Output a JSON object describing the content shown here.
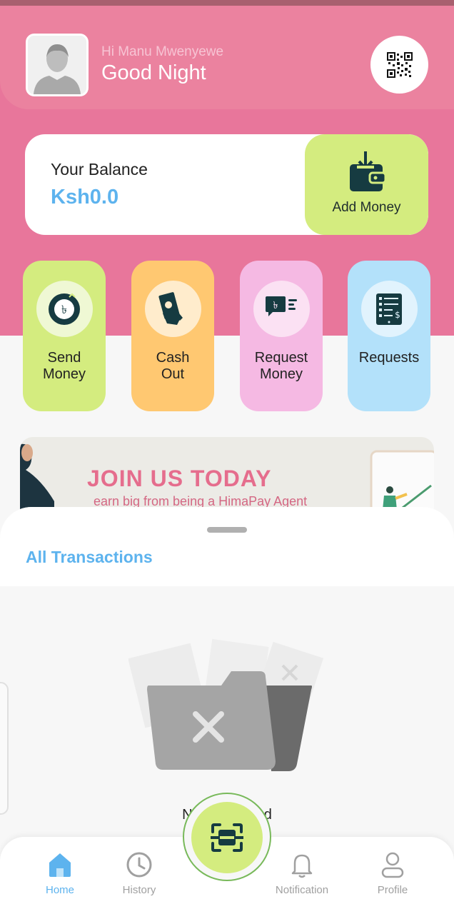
{
  "header": {
    "greeting_name": "Hi Manu Mwenyewe",
    "greeting": "Good Night",
    "avatar_icon": "user-avatar-icon",
    "qr_icon": "qr-code-icon"
  },
  "balance": {
    "label": "Your Balance",
    "value": "Ksh0.0",
    "add_money_label": "Add Money"
  },
  "actions": [
    {
      "label": "Send\nMoney",
      "icon": "send-money-icon",
      "bg": "#d4ec7f"
    },
    {
      "label": "Cash\nOut",
      "icon": "cash-out-icon",
      "bg": "#ffc871"
    },
    {
      "label": "Request\nMoney",
      "icon": "request-money-icon",
      "bg": "#f5b9e3"
    },
    {
      "label": "Requests",
      "icon": "requests-icon",
      "bg": "#b3e1fa"
    }
  ],
  "banner": {
    "title": "JOIN US TODAY",
    "subtitle": "earn big from being a HimaPay Agent"
  },
  "transactions": {
    "title": "All Transactions",
    "empty_text": "No data found"
  },
  "nav": {
    "items": [
      {
        "label": "Home",
        "icon": "home-icon",
        "active": true
      },
      {
        "label": "History",
        "icon": "clock-icon",
        "active": false
      },
      {
        "label": "Notification",
        "icon": "bell-icon",
        "active": false
      },
      {
        "label": "Profile",
        "icon": "profile-icon",
        "active": false
      }
    ],
    "scan_icon": "scan-icon"
  },
  "colors": {
    "brand_pink": "#e8769b",
    "accent_green": "#d4ec7f",
    "accent_blue": "#5db3ee",
    "dark_teal": "#163b41"
  }
}
